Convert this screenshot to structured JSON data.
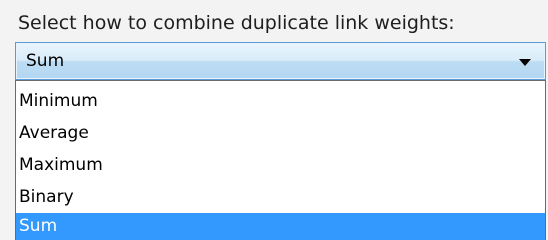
{
  "panel": {
    "prompt": "Select how to combine duplicate link weights:"
  },
  "combo": {
    "selected_value": "Sum",
    "arrow_icon": "chevron-down-icon",
    "accent_color": "#5b9bd5"
  },
  "dropdown": {
    "options": [
      {
        "label": "Minimum",
        "selected": false
      },
      {
        "label": "Average",
        "selected": false
      },
      {
        "label": "Maximum",
        "selected": false
      },
      {
        "label": "Binary",
        "selected": false
      },
      {
        "label": "Sum",
        "selected": true
      }
    ],
    "highlight_color": "#3399ff"
  }
}
